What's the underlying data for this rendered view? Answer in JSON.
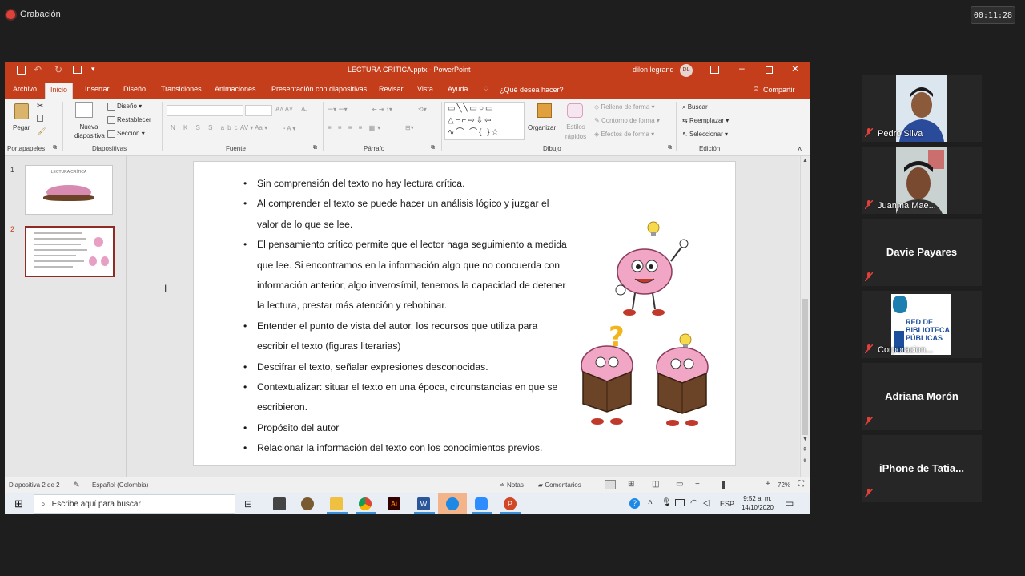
{
  "recording": {
    "label": "Grabación",
    "timer": "00:11:28"
  },
  "powerpoint": {
    "filename": "LECTURA CRÍTICA.pptx - PowerPoint",
    "user": "dilon legrand",
    "user_initials": "DL",
    "tabs": [
      "Archivo",
      "Inicio",
      "Insertar",
      "Diseño",
      "Transiciones",
      "Animaciones",
      "Presentación con diapositivas",
      "Revisar",
      "Vista",
      "Ayuda"
    ],
    "tell_me": "¿Qué desea hacer?",
    "share": "Compartir",
    "ribbon": {
      "paste": "Pegar",
      "new_slide": "Nueva diapositiva",
      "layout": "Diseño",
      "reset": "Restablecer",
      "section": "Sección",
      "arrange": "Organizar",
      "quick_styles": "Estilos rápidos",
      "shape_fill": "Relleno de forma",
      "shape_outline": "Contorno de forma",
      "shape_effects": "Efectos de forma",
      "find": "Buscar",
      "replace": "Reemplazar",
      "select": "Seleccionar",
      "font_buttons": "N K S S abc",
      "groups": {
        "clipboard": "Portapapeles",
        "slides": "Diapositivas",
        "font": "Fuente",
        "paragraph": "Párrafo",
        "drawing": "Dibujo",
        "editing": "Edición"
      }
    },
    "thumbnails": [
      {
        "num": "1",
        "title": "LECTURA CRÍTICA"
      },
      {
        "num": "2",
        "title": ""
      }
    ],
    "slide_bullets": [
      "Sin comprensión del texto no hay lectura crítica.",
      "Al comprender el texto se puede hacer un análisis lógico y juzgar el valor de lo que se lee.",
      "El pensamiento crítico permite que el lector  haga seguimiento a medida que lee. Si encontramos en la información algo que no concuerda con información anterior, algo inverosímil, tenemos la capacidad de detener la lectura, prestar más atención y  rebobinar.",
      "Entender el punto de vista del autor, los recursos que utiliza para escribir el texto (figuras literarias)",
      "Descifrar el texto, señalar expresiones desconocidas.",
      "Contextualizar: situar el texto  en una época, circunstancias en que se escribieron.",
      "Propósito del autor",
      "Relacionar la información del texto con los conocimientos previos."
    ],
    "status": {
      "slide_info": "Diapositiva 2 de 2",
      "language": "Español (Colombia)",
      "notes": "Notas",
      "comments": "Comentarios",
      "zoom": "72%"
    }
  },
  "windows_taskbar": {
    "search_placeholder": "Escribe aquí para buscar",
    "lang": "ESP",
    "time": "9:52 a. m.",
    "date": "14/10/2020"
  },
  "participants": [
    {
      "name": "Pedro Silva",
      "has_video": true
    },
    {
      "name": "Juanma Mae...",
      "has_video": true
    },
    {
      "name": "Davie Payares",
      "has_video": false
    },
    {
      "name": "Corporacion...",
      "has_video": true,
      "logo_text": "RED DE BIBLIOTECA PÚBLICAS"
    },
    {
      "name": "Adriana Morón",
      "has_video": false
    },
    {
      "name": "iPhone de Tatia...",
      "has_video": false
    }
  ],
  "colors": {
    "ppt_accent": "#c43e1c",
    "mute_icon": "#e0403a"
  }
}
